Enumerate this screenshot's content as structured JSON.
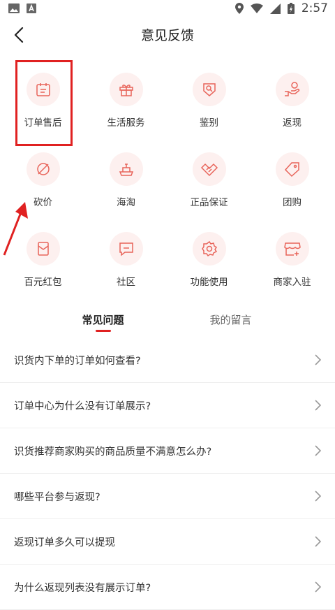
{
  "status_bar": {
    "time": "2:57"
  },
  "header": {
    "title": "意见反馈"
  },
  "categories": [
    {
      "label": "订单售后",
      "icon": "calendar-icon"
    },
    {
      "label": "生活服务",
      "icon": "gift-icon"
    },
    {
      "label": "鉴别",
      "icon": "magnifier-badge-icon"
    },
    {
      "label": "返现",
      "icon": "hand-coin-icon"
    },
    {
      "label": "砍价",
      "icon": "tag-slash-icon"
    },
    {
      "label": "海淘",
      "icon": "ship-icon"
    },
    {
      "label": "正品保证",
      "icon": "handshake-icon"
    },
    {
      "label": "团购",
      "icon": "price-tag-icon"
    },
    {
      "label": "百元红包",
      "icon": "red-envelope-icon"
    },
    {
      "label": "社区",
      "icon": "chat-bubble-icon"
    },
    {
      "label": "功能使用",
      "icon": "gear-icon"
    },
    {
      "label": "商家入驻",
      "icon": "store-icon"
    }
  ],
  "tabs": [
    {
      "label": "常见问题",
      "active": true
    },
    {
      "label": "我的留言",
      "active": false
    }
  ],
  "faq": [
    "识货内下单的订单如何查看?",
    "订单中心为什么没有订单展示?",
    "识货推荐商家购买的商品质量不满意怎么办?",
    "哪些平台参与返现?",
    "返现订单多久可以提现",
    "为什么返现列表没有展示订单?"
  ],
  "colors": {
    "accent": "#e02121",
    "icon_bg": "#fdf0ef",
    "icon_stroke": "#e8645a"
  }
}
